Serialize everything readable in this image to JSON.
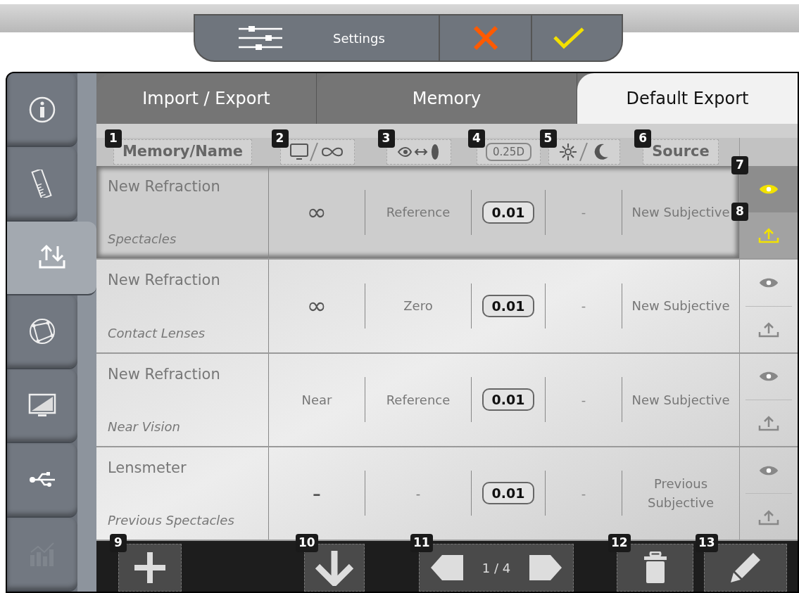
{
  "toolbar": {
    "title": "Settings"
  },
  "sidebar": [
    {
      "kind": "info",
      "selected": false,
      "disabled": false
    },
    {
      "kind": "ruler",
      "selected": false,
      "disabled": false
    },
    {
      "kind": "import-export",
      "selected": true,
      "disabled": false
    },
    {
      "kind": "globe",
      "selected": false,
      "disabled": false
    },
    {
      "kind": "monitor",
      "selected": false,
      "disabled": false
    },
    {
      "kind": "usb",
      "selected": false,
      "disabled": false
    },
    {
      "kind": "chart",
      "selected": false,
      "disabled": true
    }
  ],
  "tabs": [
    {
      "label": "Import / Export",
      "selected": false
    },
    {
      "label": "Memory",
      "selected": false
    },
    {
      "label": "Default Export",
      "selected": true
    }
  ],
  "columns": [
    {
      "kind": "text",
      "label": "Memory/Name",
      "badge": "1"
    },
    {
      "kind": "display-distance",
      "badge": "2"
    },
    {
      "kind": "eye-lens",
      "badge": "3"
    },
    {
      "kind": "step",
      "label": "0.25D",
      "badge": "4"
    },
    {
      "kind": "day-night",
      "badge": "5"
    },
    {
      "kind": "text",
      "label": "Source",
      "badge": "6"
    }
  ],
  "rows": [
    {
      "name": "New Refraction",
      "type": "Spectacles",
      "distance": "∞",
      "reference": "Reference",
      "step": "0.01",
      "lighting": "-",
      "source": "New Subjective",
      "selected": true,
      "view_badge": "7",
      "export_badge": "8"
    },
    {
      "name": "New Refraction",
      "type": "Contact Lenses",
      "distance": "∞",
      "reference": "Zero",
      "step": "0.01",
      "lighting": "-",
      "source": "New Subjective",
      "selected": false
    },
    {
      "name": "New Refraction",
      "type": "Near Vision",
      "distance": "Near",
      "reference": "Reference",
      "step": "0.01",
      "lighting": "-",
      "source": "New Subjective",
      "selected": false
    },
    {
      "name": "Lensmeter",
      "type": "Previous Spectacles",
      "distance": "-",
      "reference": "-",
      "step": "0.01",
      "lighting": "-",
      "source": "Previous Subjective",
      "selected": false
    }
  ],
  "bottom_bar": [
    {
      "kind": "add",
      "badge": "9"
    },
    {
      "kind": "down",
      "badge": "10"
    },
    {
      "kind": "pager",
      "badge": "11",
      "page": "1 / 4"
    },
    {
      "kind": "delete",
      "badge": "12"
    },
    {
      "kind": "edit",
      "badge": "13"
    }
  ]
}
